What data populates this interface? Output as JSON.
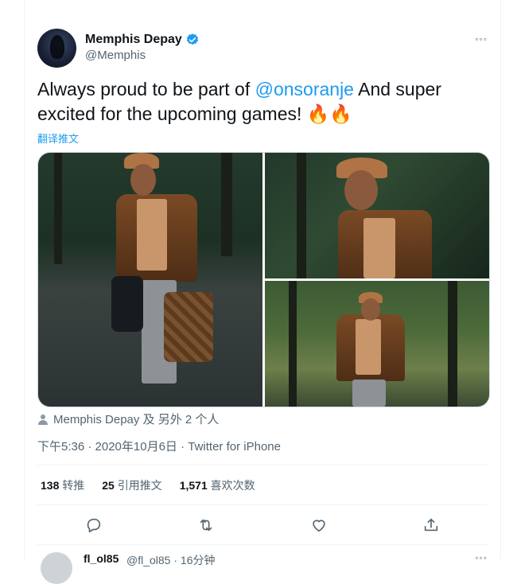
{
  "tweet": {
    "author_name": "Memphis Depay",
    "author_handle": "@Memphis",
    "more_label": "◦◦◦",
    "text_before": "Always proud to be part of ",
    "mention": "@onsoranje",
    "text_after": " And super excited for the upcoming games! ",
    "emoji": "🔥🔥",
    "translate_label": "翻译推文",
    "attribution": "Memphis Depay 及 另外 2 个人",
    "timestamp": "下午5:36 · 2020年10月6日 · Twitter for iPhone"
  },
  "stats": [
    {
      "count": "138",
      "label": "转推"
    },
    {
      "count": "25",
      "label": "引用推文"
    },
    {
      "count": "1,571",
      "label": "喜欢次数"
    }
  ],
  "actions": [
    "reply-icon",
    "retweet-icon",
    "like-icon",
    "share-icon"
  ],
  "next_tweet": {
    "name": "fl_ol85",
    "handle": "@fl_ol85 · 16分钟",
    "more_label": "◦◦◦"
  },
  "colors": {
    "accent": "#1d9bf0",
    "secondary_text": "#536471",
    "primary_text": "#0f1419",
    "divider": "#eff3f4"
  }
}
